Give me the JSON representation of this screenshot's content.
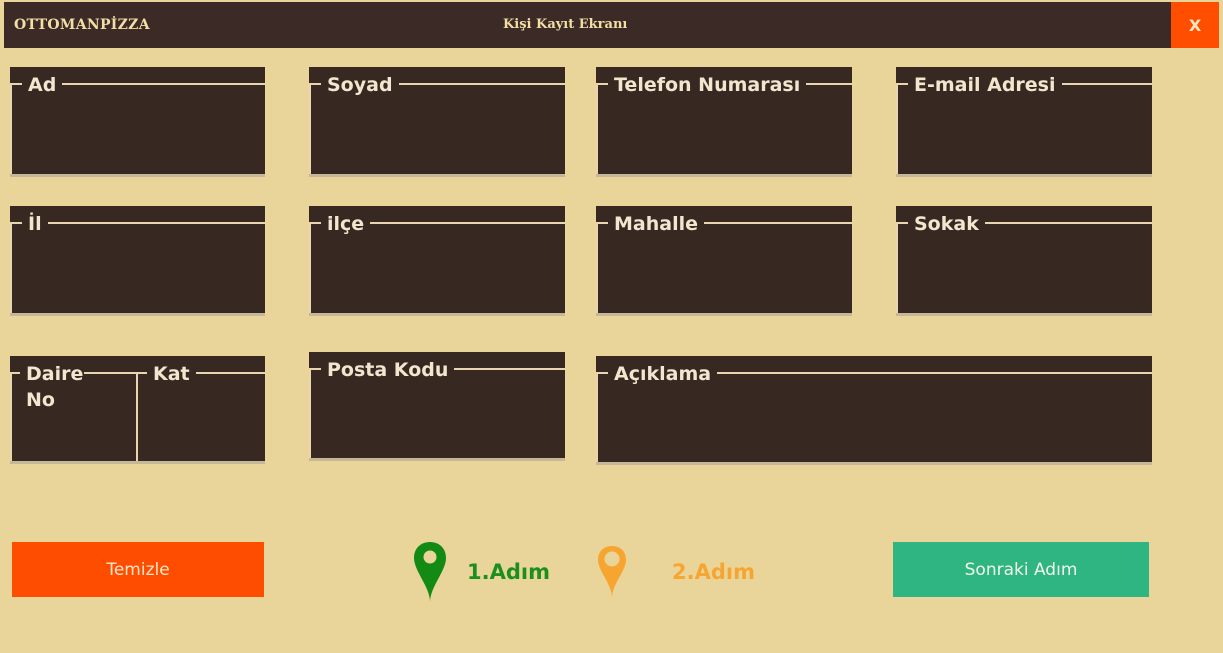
{
  "window": {
    "app_name": "OTTOMANPİZZA",
    "title": "Kişi Kayıt Ekranı",
    "close_label": "X"
  },
  "form": {
    "fields": {
      "ad": {
        "label": "Ad",
        "value": ""
      },
      "soyad": {
        "label": "Soyad",
        "value": ""
      },
      "telefon": {
        "label": "Telefon Numarası",
        "value": ""
      },
      "email": {
        "label": "E-mail Adresi",
        "value": ""
      },
      "il": {
        "label": "İl",
        "value": ""
      },
      "ilce": {
        "label": "ilçe",
        "value": ""
      },
      "mahalle": {
        "label": "Mahalle",
        "value": ""
      },
      "sokak": {
        "label": "Sokak",
        "value": ""
      },
      "daire_no": {
        "label": "Daire No",
        "value": ""
      },
      "kat": {
        "label": "Kat",
        "value": ""
      },
      "posta_kodu": {
        "label": "Posta Kodu",
        "value": ""
      },
      "aciklama": {
        "label": "Açıklama",
        "value": ""
      }
    }
  },
  "footer": {
    "clear_label": "Temizle",
    "next_label": "Sonraki Adım",
    "steps": [
      {
        "label": "1.Adım",
        "icon": "map-pin-filled-icon",
        "color": "#1e8f1e",
        "active": true
      },
      {
        "label": "2.Adım",
        "icon": "map-pin-outline-icon",
        "color": "#f6a630",
        "active": false
      }
    ]
  },
  "colors": {
    "background": "#e9d59a",
    "titlebar": "#3b2a25",
    "field_bg": "#382822",
    "clear_button": "#ff4d00",
    "next_button": "#2fb582",
    "close_button": "#ff4e00"
  }
}
